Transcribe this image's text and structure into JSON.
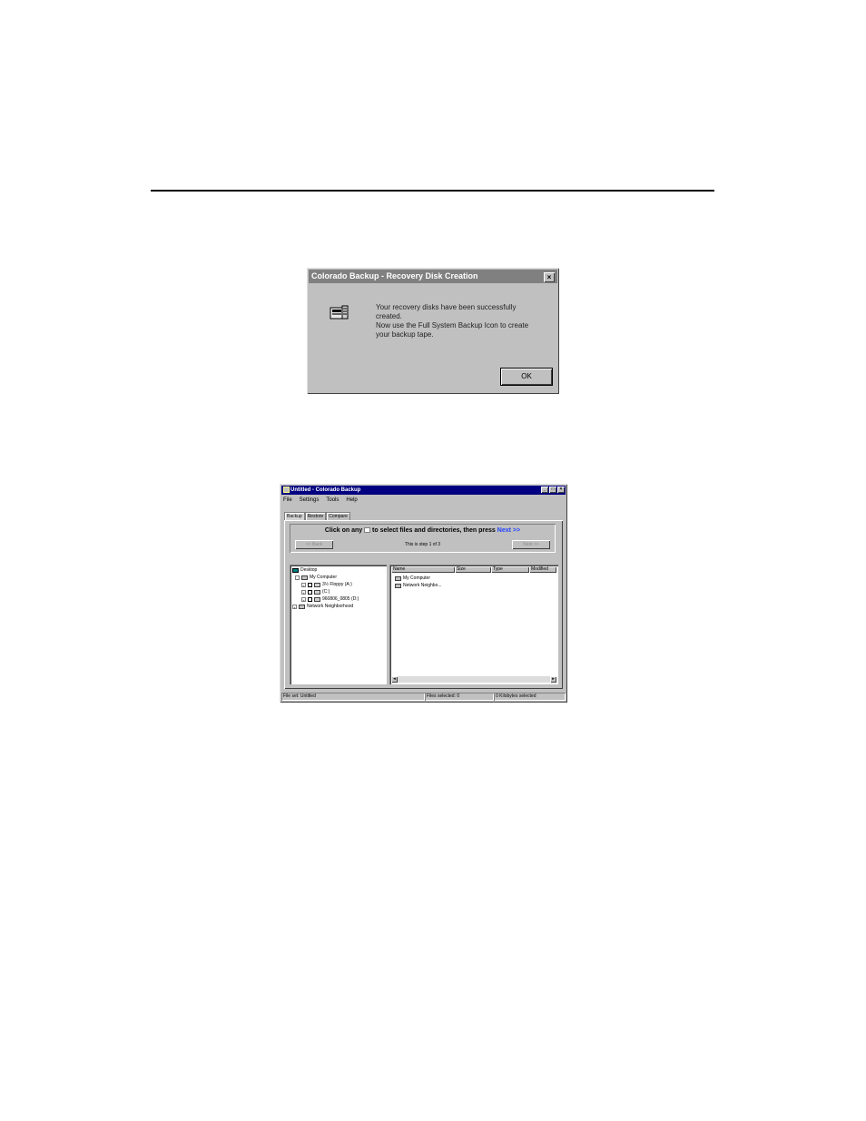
{
  "dialog": {
    "title": "Colorado Backup - Recovery Disk Creation",
    "close_label": "×",
    "message_lines": [
      "Your recovery disks have been successfully",
      "created.",
      "Now use the Full System Backup Icon to create",
      "your backup tape."
    ],
    "ok_label": "OK"
  },
  "window": {
    "title": "Untitled - Colorado Backup",
    "title_buttons": [
      "_",
      "□",
      "×"
    ],
    "menu": [
      "File",
      "Settings",
      "Tools",
      "Help"
    ],
    "tabs": [
      "Backup",
      "Restore",
      "Compare"
    ],
    "wizard": {
      "instruction_before": "Click on any",
      "instruction_after": "to select files and directories, then press",
      "next_word": "Next >>",
      "step_text": "This is step 1 of 3",
      "back_label": "<< Back",
      "next_label": "Next >>"
    },
    "tree": [
      {
        "label": "Desktop",
        "expander": "",
        "icon": "desktop-icon",
        "indent": 0
      },
      {
        "label": "My Computer",
        "expander": "-",
        "icon": "computer-icon",
        "indent": 1
      },
      {
        "label": "3½ Floppy (A:)",
        "expander": "+",
        "icon": "floppy-drive-icon",
        "indent": 2
      },
      {
        "label": "(C:)",
        "expander": "+",
        "icon": "hard-drive-icon",
        "indent": 2
      },
      {
        "label": "960806_0805 (D:)",
        "expander": "+",
        "icon": "cd-drive-icon",
        "indent": 2
      },
      {
        "label": "Network Neighborhood",
        "expander": "+",
        "icon": "network-icon",
        "indent": 0
      }
    ],
    "list_columns": [
      "Name",
      "Size",
      "Type",
      "Modified"
    ],
    "list_items": [
      {
        "label": "My Computer",
        "icon": "computer-icon"
      },
      {
        "label": "Network Neighbo...",
        "icon": "network-icon"
      }
    ],
    "status": [
      "File set: Untitled",
      "Files selected: 0",
      "0 Kilobytes selected"
    ]
  }
}
